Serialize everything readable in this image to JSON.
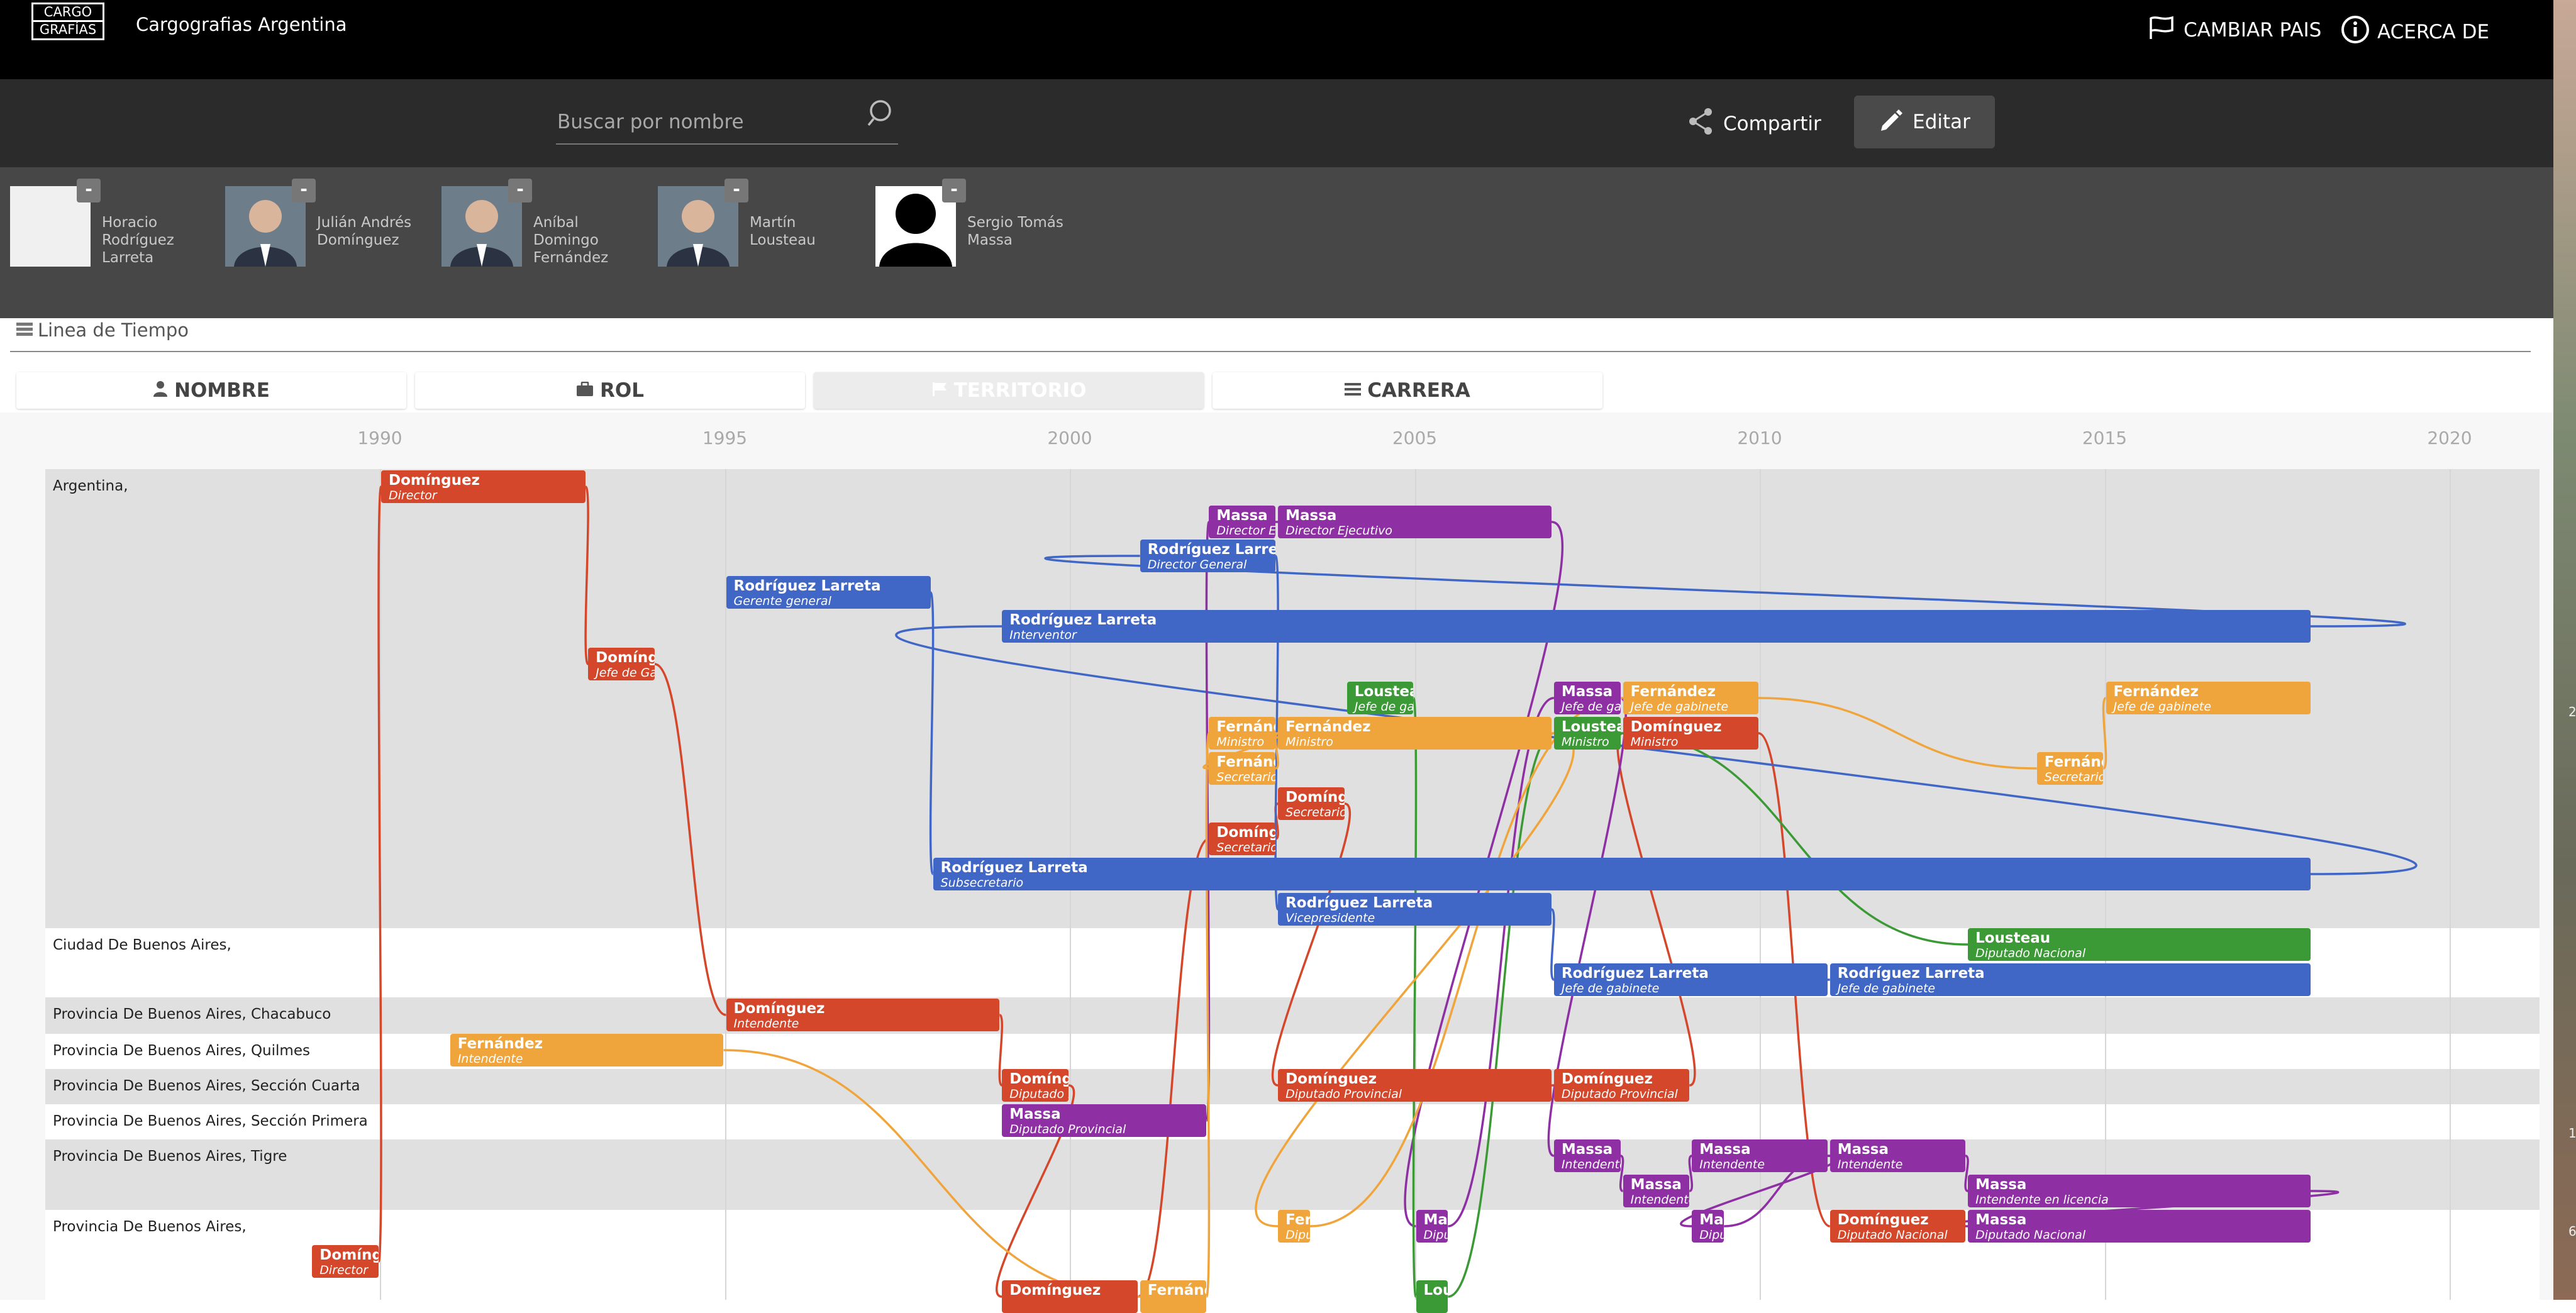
{
  "topbar": {
    "logo_line1": "CARGO",
    "logo_line2": "GRAFÍAS",
    "app_title": "Cargografias Argentina",
    "change_country": "CAMBIAR PAIS",
    "about": "ACERCA DE"
  },
  "search": {
    "placeholder": "Buscar por nombre",
    "value": ""
  },
  "actions": {
    "share": "Compartir",
    "edit": "Editar"
  },
  "people": [
    {
      "name": "Horacio Rodríguez Larreta",
      "l1": "Horacio",
      "l2": "Rodríguez",
      "l3": "Larreta",
      "avatar": "blank"
    },
    {
      "name": "Julián Andrés Domínguez",
      "l1": "Julián Andrés",
      "l2": "Domínguez",
      "l3": "",
      "avatar": "photo"
    },
    {
      "name": "Aníbal Domingo Fernández",
      "l1": "Aníbal",
      "l2": "Domingo",
      "l3": "Fernández",
      "avatar": "photo"
    },
    {
      "name": "Martín Lousteau",
      "l1": "Martín",
      "l2": "Lousteau",
      "l3": "",
      "avatar": "photo"
    },
    {
      "name": "Sergio Tomás Massa",
      "l1": "Sergio Tomás",
      "l2": "Massa",
      "l3": "",
      "avatar": "silhouette"
    }
  ],
  "remove_label": "-",
  "timeline": {
    "section_title": "Linea de Tiempo",
    "tabs": [
      {
        "label": "NOMBRE",
        "enabled": true
      },
      {
        "label": "ROL",
        "enabled": true
      },
      {
        "label": "TERRITORIO",
        "enabled": false
      },
      {
        "label": "CARRERA",
        "enabled": true
      }
    ],
    "years": [
      "1990",
      "1995",
      "2000",
      "2005",
      "2010",
      "2015",
      "2020"
    ],
    "rows": [
      {
        "label": "Argentina,"
      },
      {
        "label": "Ciudad De Buenos Aires,"
      },
      {
        "label": "Provincia De Buenos Aires, Chacabuco"
      },
      {
        "label": "Provincia De Buenos Aires, Quilmes"
      },
      {
        "label": "Provincia De Buenos Aires, Sección Cuarta"
      },
      {
        "label": "Provincia De Buenos Aires, Sección Primera"
      },
      {
        "label": "Provincia De Buenos Aires, Tigre"
      },
      {
        "label": "Provincia De Buenos Aires,"
      }
    ],
    "colors": {
      "Domínguez": "#d4472a",
      "Fernández": "#f0a53c",
      "Rodríguez Larreta": "#4066c6",
      "Massa": "#8e2fa3",
      "Lousteau": "#3c9a36"
    },
    "segments": [
      {
        "person": "Domínguez",
        "role": "Director",
        "start": 1990.0,
        "end": 1993.0
      },
      {
        "person": "Domínguez",
        "role": "Jefe de Gabinete de Asesores",
        "start": 1993.0,
        "end": 1994.0
      },
      {
        "person": "Rodríguez Larreta",
        "role": "Gerente general",
        "start": 1995.0,
        "end": 1998.0
      },
      {
        "person": "Rodríguez Larreta",
        "role": "Interventor",
        "start": 1999.0,
        "end": 2018.0
      },
      {
        "person": "Rodríguez Larreta",
        "role": "Director General",
        "start": 2001.0,
        "end": 2003.0
      },
      {
        "person": "Massa",
        "role": "Director Ejecutivo",
        "start": 2002.0,
        "end": 2003.0
      },
      {
        "person": "Massa",
        "role": "Director Ejecutivo",
        "start": 2003.0,
        "end": 2007.0
      },
      {
        "person": "Lousteau",
        "role": "Jefe de gabinete",
        "start": 2004.0,
        "end": 2005.0
      },
      {
        "person": "Massa",
        "role": "Jefe de gabinete",
        "start": 2007.0,
        "end": 2008.0
      },
      {
        "person": "Fernández",
        "role": "Jefe de gabinete",
        "start": 2008.0,
        "end": 2010.0
      },
      {
        "person": "Fernández",
        "role": "Jefe de gabinete",
        "start": 2015.0,
        "end": 2018.0
      },
      {
        "person": "Fernández",
        "role": "Ministro",
        "start": 2002.0,
        "end": 2003.0
      },
      {
        "person": "Fernández",
        "role": "Ministro",
        "start": 2003.0,
        "end": 2007.0
      },
      {
        "person": "Lousteau",
        "role": "Ministro",
        "start": 2007.0,
        "end": 2008.0
      },
      {
        "person": "Domínguez",
        "role": "Ministro",
        "start": 2008.0,
        "end": 2010.0
      },
      {
        "person": "Fernández",
        "role": "Secretario",
        "start": 2002.0,
        "end": 2003.0
      },
      {
        "person": "Fernández",
        "role": "Secretario",
        "start": 2014.0,
        "end": 2015.0
      },
      {
        "person": "Domínguez",
        "role": "Secretario de Asuntos Militares",
        "start": 2003.0,
        "end": 2004.0
      },
      {
        "person": "Domínguez",
        "role": "Secretario de Gabinete y Relaciones Parlamentarias",
        "start": 2002.0,
        "end": 2003.0
      },
      {
        "person": "Rodríguez Larreta",
        "role": "Subsecretario",
        "start": 1998.0,
        "end": 2018.0
      },
      {
        "person": "Rodríguez Larreta",
        "role": "Vicepresidente",
        "start": 2003.0,
        "end": 2007.0
      },
      {
        "person": "Lousteau",
        "role": "Diputado Nacional",
        "start": 2013.0,
        "end": 2018.0
      },
      {
        "person": "Rodríguez Larreta",
        "role": "Jefe de gabinete",
        "start": 2007.0,
        "end": 2011.0
      },
      {
        "person": "Rodríguez Larreta",
        "role": "Jefe de gabinete",
        "start": 2011.0,
        "end": 2018.0
      },
      {
        "person": "Domínguez",
        "role": "Intendente",
        "start": 1995.0,
        "end": 1999.0
      },
      {
        "person": "Fernández",
        "role": "Intendente",
        "start": 1991.0,
        "end": 1995.0
      },
      {
        "person": "Domínguez",
        "role": "Diputado Provincial",
        "start": 1999.0,
        "end": 2000.0
      },
      {
        "person": "Domínguez",
        "role": "Diputado Provincial",
        "start": 2003.0,
        "end": 2007.0
      },
      {
        "person": "Domínguez",
        "role": "Diputado Provincial",
        "start": 2007.0,
        "end": 2009.0
      },
      {
        "person": "Massa",
        "role": "Diputado Provincial",
        "start": 1999.0,
        "end": 2002.0
      },
      {
        "person": "Massa",
        "role": "Intendente",
        "start": 2007.0,
        "end": 2008.0
      },
      {
        "person": "Massa",
        "role": "Intendente",
        "start": 2009.0,
        "end": 2011.0
      },
      {
        "person": "Massa",
        "role": "Intendente",
        "start": 2011.0,
        "end": 2013.0
      },
      {
        "person": "Massa",
        "role": "Intendente en licencia",
        "start": 2008.0,
        "end": 2009.0
      },
      {
        "person": "Massa",
        "role": "Intendente en licencia",
        "start": 2013.0,
        "end": 2018.0
      },
      {
        "person": "Fernández",
        "role": "Diputado",
        "start": 2003.0,
        "end": 2003.5
      },
      {
        "person": "Massa",
        "role": "Diputado",
        "start": 2005.0,
        "end": 2005.5
      },
      {
        "person": "Massa",
        "role": "Diputado",
        "start": 2009.0,
        "end": 2009.5
      },
      {
        "person": "Domínguez",
        "role": "Diputado Nacional",
        "start": 2011.0,
        "end": 2013.0
      },
      {
        "person": "Massa",
        "role": "Diputado Nacional",
        "start": 2013.0,
        "end": 2018.0
      },
      {
        "person": "Domínguez",
        "role": "Director",
        "start": 1989.0,
        "end": 1990.0
      },
      {
        "person": "Domínguez",
        "role": "",
        "start": 1999.0,
        "end": 2001.0
      },
      {
        "person": "Fernández",
        "role": "",
        "start": 2001.0,
        "end": 2002.0
      },
      {
        "person": "Lousteau",
        "role": "",
        "start": 2005.0,
        "end": 2005.5
      }
    ]
  },
  "side_numbers": [
    "2",
    "1",
    "6"
  ]
}
